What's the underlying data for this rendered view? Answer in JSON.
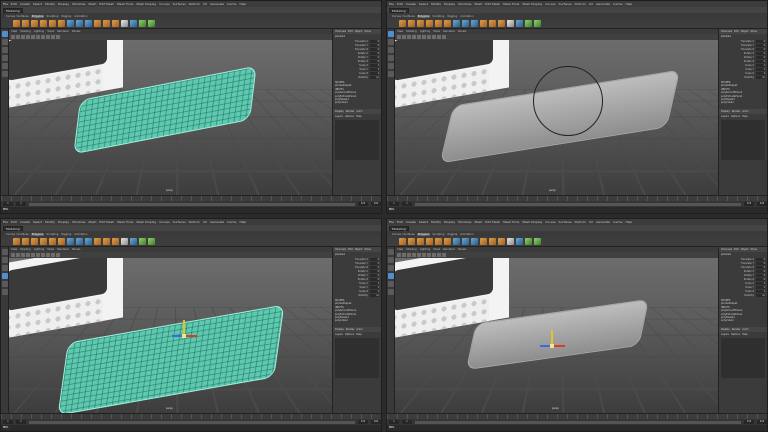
{
  "app": {
    "menus": [
      "File",
      "Edit",
      "Create",
      "Select",
      "Modify",
      "Display",
      "Windows",
      "Mesh",
      "Edit Mesh",
      "Mesh Tools",
      "Mesh Display",
      "Curves",
      "Surfaces",
      "Deform",
      "UV",
      "Generate",
      "Cache",
      "Help"
    ],
    "mode": "Modeling",
    "shelf_tabs": [
      "Curves / Surfaces",
      "Polygons",
      "Sculpting",
      "Rigging",
      "Animation",
      "Rendering",
      "FX",
      "FX Caching",
      "Custom",
      "XGen"
    ],
    "active_shelf_tab": "Polygons",
    "viewport_menus": [
      "View",
      "Shading",
      "Lighting",
      "Show",
      "Renderer",
      "Panels"
    ],
    "camera": "persp",
    "channel_tabs": [
      "Channels",
      "Edit",
      "Object",
      "Show"
    ],
    "object_name": "pCube1",
    "channels": [
      {
        "label": "Translate X",
        "value": "0"
      },
      {
        "label": "Translate Y",
        "value": "0"
      },
      {
        "label": "Translate Z",
        "value": "0"
      },
      {
        "label": "Rotate X",
        "value": "0"
      },
      {
        "label": "Rotate Y",
        "value": "0"
      },
      {
        "label": "Rotate Z",
        "value": "0"
      },
      {
        "label": "Scale X",
        "value": "1"
      },
      {
        "label": "Scale Y",
        "value": "1"
      },
      {
        "label": "Scale Z",
        "value": "1"
      },
      {
        "label": "Visibility",
        "value": "on"
      }
    ],
    "history": [
      "SHAPES",
      "pCubeShape1",
      "INPUTS",
      "polySmoothFace1",
      "polyExtrudeFace1",
      "polyTweak1",
      "polyCube1"
    ],
    "layer_tabs": [
      "Display",
      "Render",
      "Anim"
    ],
    "layer_menus": [
      "Layers",
      "Options",
      "Help"
    ],
    "range": {
      "start": "1",
      "start_inner": "1",
      "end_inner": "120",
      "end": "200"
    },
    "char_set": "No Character Set",
    "anim_layer": "No Anim Layer",
    "fps": "24 fps",
    "cmd_label": "MEL"
  },
  "panels": [
    {
      "id": "top-left",
      "style": "wireframe"
    },
    {
      "id": "top-right",
      "style": "shaded-brush"
    },
    {
      "id": "bottom-left",
      "style": "wireframe-manip"
    },
    {
      "id": "bottom-right",
      "style": "shaded-manip"
    }
  ]
}
